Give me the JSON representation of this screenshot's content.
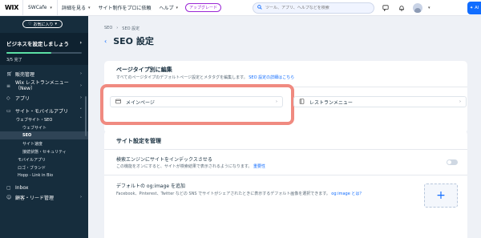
{
  "topbar": {
    "logo": "WIX",
    "site_name": "SWCafe",
    "menu": [
      "詳細を見る",
      "サイト制作をプロに依頼",
      "ヘルプ"
    ],
    "upgrade": "アップグレード",
    "search_placeholder": "ツール、アプリ、ヘルプなどを検索",
    "ai_label": "AI"
  },
  "sidebar": {
    "favorites": "お気に入り",
    "setup_title": "ビジネスを設定しましょう",
    "setup_count": "3/5 完了",
    "setup_progress": 0.6,
    "items": [
      {
        "label": "販売管理"
      },
      {
        "label": "Wix レストランメニュー（New）"
      },
      {
        "label": "アプリ"
      },
      {
        "label": "サイト・モバイルアプリ"
      }
    ],
    "sub": {
      "label": "ウェブサイト・SEO"
    },
    "subsub": [
      "ウェブサイト",
      "SEO",
      "サイト速度",
      "接続状態・セキュリティ"
    ],
    "sub2": [
      "モバイルアプリ",
      "ロゴ・ブランド",
      "Hopp - Link in Bio"
    ],
    "bottom": [
      "Inbox",
      "顧客・リード管理"
    ]
  },
  "main": {
    "breadcrumbs": [
      "SEO",
      "SEO 設定"
    ],
    "title": "SEO 設定",
    "card1": {
      "title": "ページタイプ別に編集",
      "desc": "すべてのページタイプのデフォルトページ設定とメタタグを編集します。",
      "link": "SEO 設定の詳細はこちら",
      "types": [
        "メインページ",
        "レストランメニュー"
      ]
    },
    "card2": {
      "title": "サイト設定を管理",
      "index_title": "検索エンジンにサイトをインデックスさせる",
      "index_desc": "この機能をオンにすると、サイトが検索結果で表示されるようになります。",
      "index_link": "重要性",
      "ogimage_title": "デフォルトの og:image を追加",
      "ogimage_desc": "Facebook、Pinterest、Twitter などの SNS でサイトがシェアされたときに表示するデフォルト画像を選択できます。",
      "ogimage_link": "og:image とは？"
    }
  }
}
